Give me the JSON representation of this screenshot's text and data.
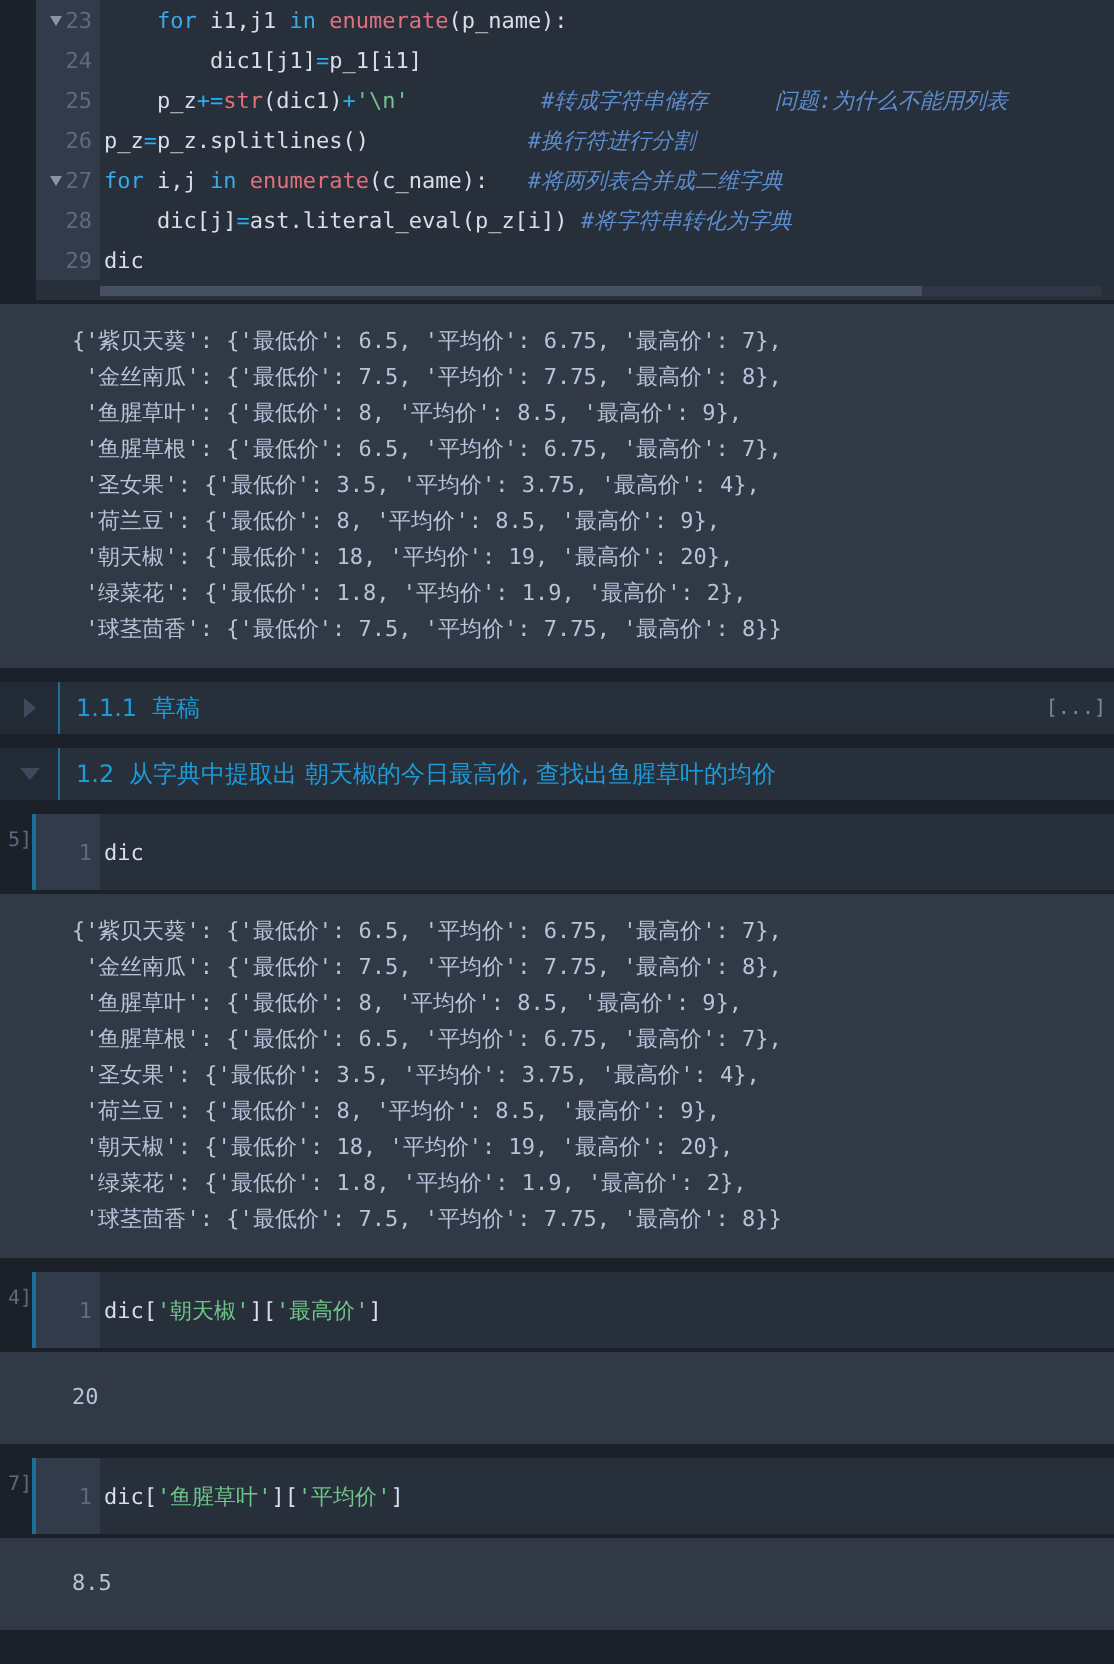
{
  "cells": [
    {
      "kind": "code",
      "scrollbar": true,
      "lines": [
        {
          "number": "23",
          "fold": true,
          "tokens": [
            {
              "kind": "keyword",
              "text": "    for"
            },
            {
              "kind": "plain",
              "text": " i1,j1 "
            },
            {
              "kind": "keyword",
              "text": "in "
            },
            {
              "kind": "builtin",
              "text": "enumerate"
            },
            {
              "kind": "plain",
              "text": "(p_name):"
            }
          ]
        },
        {
          "number": "24",
          "fold": false,
          "tokens": [
            {
              "kind": "plain",
              "text": "        dic1[j1]"
            },
            {
              "kind": "operator",
              "text": "="
            },
            {
              "kind": "plain",
              "text": "p_1[i1]"
            }
          ]
        },
        {
          "number": "25",
          "fold": false,
          "tokens": [
            {
              "kind": "plain",
              "text": "    p_z"
            },
            {
              "kind": "operator",
              "text": "+="
            },
            {
              "kind": "builtin",
              "text": "str"
            },
            {
              "kind": "plain",
              "text": "(dic1)"
            },
            {
              "kind": "operator",
              "text": "+"
            },
            {
              "kind": "string",
              "text": "'\\n'"
            },
            {
              "kind": "comment",
              "text": "          #转成字符串储存     问题:为什么不能用列表"
            }
          ]
        },
        {
          "number": "26",
          "fold": false,
          "tokens": [
            {
              "kind": "plain",
              "text": "p_z"
            },
            {
              "kind": "operator",
              "text": "="
            },
            {
              "kind": "plain",
              "text": "p_z.splitlines()            "
            },
            {
              "kind": "comment",
              "text": "#换行符进行分割"
            }
          ]
        },
        {
          "number": "27",
          "fold": true,
          "tokens": [
            {
              "kind": "keyword",
              "text": "for"
            },
            {
              "kind": "plain",
              "text": " i,j "
            },
            {
              "kind": "keyword",
              "text": "in "
            },
            {
              "kind": "builtin",
              "text": "enumerate"
            },
            {
              "kind": "plain",
              "text": "(c_name):   "
            },
            {
              "kind": "comment",
              "text": "#将两列表合并成二维字典"
            }
          ]
        },
        {
          "number": "28",
          "fold": false,
          "tokens": [
            {
              "kind": "plain",
              "text": "    dic[j]"
            },
            {
              "kind": "operator",
              "text": "="
            },
            {
              "kind": "plain",
              "text": "ast.literal_eval(p_z[i]) "
            },
            {
              "kind": "comment",
              "text": "#将字符串转化为字典"
            }
          ]
        },
        {
          "number": "29",
          "fold": false,
          "tokens": [
            {
              "kind": "plain",
              "text": "dic"
            }
          ]
        }
      ],
      "output": [
        "{'紫贝天葵': {'最低价': 6.5, '平均价': 6.75, '最高价': 7},",
        " '金丝南瓜': {'最低价': 7.5, '平均价': 7.75, '最高价': 8},",
        " '鱼腥草叶': {'最低价': 8, '平均价': 8.5, '最高价': 9},",
        " '鱼腥草根': {'最低价': 6.5, '平均价': 6.75, '最高价': 7},",
        " '圣女果': {'最低价': 3.5, '平均价': 3.75, '最高价': 4},",
        " '荷兰豆': {'最低价': 8, '平均价': 8.5, '最高价': 9},",
        " '朝天椒': {'最低价': 18, '平均价': 19, '最高价': 20},",
        " '绿菜花': {'最低价': 1.8, '平均价': 1.9, '最高价': 2},",
        " '球茎茴香': {'最低价': 7.5, '平均价': 7.75, '最高价': 8}}"
      ]
    },
    {
      "kind": "heading",
      "number": "1.1.1",
      "title": "草稿",
      "expanded": false,
      "collapsed_marker": "[...]"
    },
    {
      "kind": "heading",
      "number": "1.2",
      "title": "从字典中提取出 朝天椒的今日最高价, 查找出鱼腥草叶的均价",
      "expanded": true
    },
    {
      "kind": "code",
      "prompt": "5]",
      "scrollbar": false,
      "lines": [
        {
          "number": "1",
          "fold": false,
          "tokens": [
            {
              "kind": "plain",
              "text": "dic"
            }
          ]
        }
      ],
      "output": [
        "{'紫贝天葵': {'最低价': 6.5, '平均价': 6.75, '最高价': 7},",
        " '金丝南瓜': {'最低价': 7.5, '平均价': 7.75, '最高价': 8},",
        " '鱼腥草叶': {'最低价': 8, '平均价': 8.5, '最高价': 9},",
        " '鱼腥草根': {'最低价': 6.5, '平均价': 6.75, '最高价': 7},",
        " '圣女果': {'最低价': 3.5, '平均价': 3.75, '最高价': 4},",
        " '荷兰豆': {'最低价': 8, '平均价': 8.5, '最高价': 9},",
        " '朝天椒': {'最低价': 18, '平均价': 19, '最高价': 20},",
        " '绿菜花': {'最低价': 1.8, '平均价': 1.9, '最高价': 2},",
        " '球茎茴香': {'最低价': 7.5, '平均价': 7.75, '最高价': 8}}"
      ]
    },
    {
      "kind": "code",
      "prompt": "4]",
      "scrollbar": false,
      "lines": [
        {
          "number": "1",
          "fold": false,
          "tokens": [
            {
              "kind": "plain",
              "text": "dic["
            },
            {
              "kind": "string",
              "text": "'朝天椒'"
            },
            {
              "kind": "plain",
              "text": "]["
            },
            {
              "kind": "string",
              "text": "'最高价'"
            },
            {
              "kind": "plain",
              "text": "]"
            }
          ]
        }
      ],
      "output": [
        "20"
      ]
    },
    {
      "kind": "code",
      "prompt": "7]",
      "scrollbar": false,
      "lines": [
        {
          "number": "1",
          "fold": false,
          "tokens": [
            {
              "kind": "plain",
              "text": "dic["
            },
            {
              "kind": "string",
              "text": "'鱼腥草叶'"
            },
            {
              "kind": "plain",
              "text": "]["
            },
            {
              "kind": "string",
              "text": "'平均价'"
            },
            {
              "kind": "plain",
              "text": "]"
            }
          ]
        }
      ],
      "output": [
        "8.5"
      ]
    }
  ]
}
